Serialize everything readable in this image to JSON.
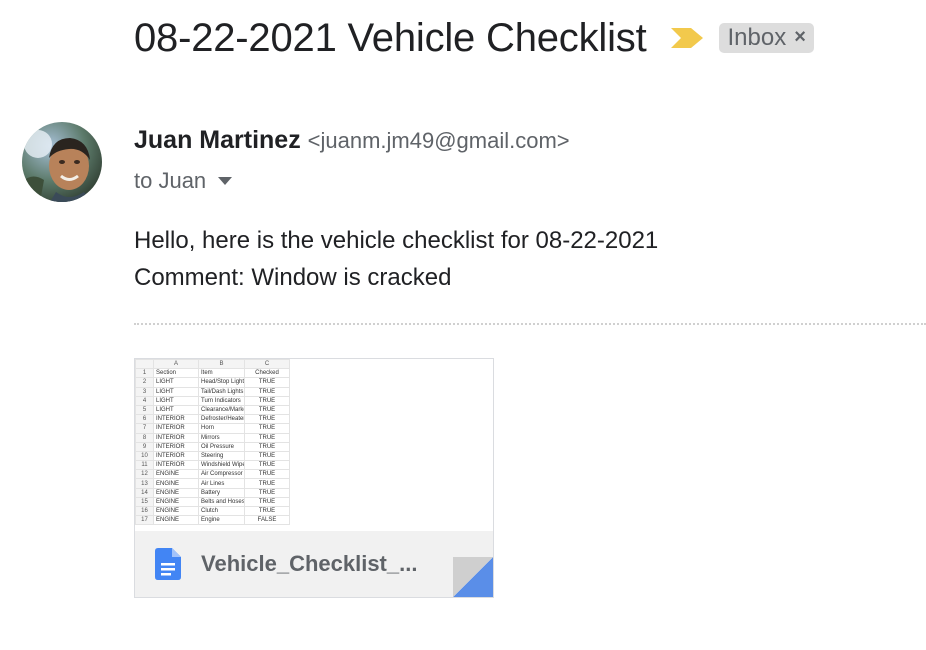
{
  "email": {
    "subject": "08-22-2021 Vehicle Checklist",
    "label": "Inbox",
    "label_remove_symbol": "×",
    "sender_name": "Juan Martinez",
    "sender_email": "<juanm.jm49@gmail.com>",
    "recipient": "to Juan",
    "body_line1": "Hello, here is the vehicle checklist for 08-22-2021",
    "body_line2": "Comment: Window is cracked"
  },
  "attachment": {
    "name": "Vehicle_Checklist_...",
    "icon": "google-docs-icon",
    "preview": {
      "columns": [
        "A",
        "B",
        "C"
      ],
      "rows": [
        [
          "1",
          "Section",
          "Item",
          "Checked"
        ],
        [
          "2",
          "LIGHT",
          "Head/Stop Lights",
          "TRUE"
        ],
        [
          "3",
          "LIGHT",
          "Tail/Dash Lights",
          "TRUE"
        ],
        [
          "4",
          "LIGHT",
          "Turn Indicators",
          "TRUE"
        ],
        [
          "5",
          "LIGHT",
          "Clearance/Marke",
          "TRUE"
        ],
        [
          "6",
          "INTERIOR",
          "Defroster/Heater",
          "TRUE"
        ],
        [
          "7",
          "INTERIOR",
          "Horn",
          "TRUE"
        ],
        [
          "8",
          "INTERIOR",
          "Mirrors",
          "TRUE"
        ],
        [
          "9",
          "INTERIOR",
          "Oil Pressure",
          "TRUE"
        ],
        [
          "10",
          "INTERIOR",
          "Steering",
          "TRUE"
        ],
        [
          "11",
          "INTERIOR",
          "Windshield Wipe",
          "TRUE"
        ],
        [
          "12",
          "ENGINE",
          "Air Compressor",
          "TRUE"
        ],
        [
          "13",
          "ENGINE",
          "Air Lines",
          "TRUE"
        ],
        [
          "14",
          "ENGINE",
          "Battery",
          "TRUE"
        ],
        [
          "15",
          "ENGINE",
          "Belts and Hoses",
          "TRUE"
        ],
        [
          "16",
          "ENGINE",
          "Clutch",
          "TRUE"
        ],
        [
          "17",
          "ENGINE",
          "Engine",
          "FALSE"
        ]
      ]
    }
  },
  "colors": {
    "importance_marker": "#f2c94c",
    "doc_icon": "#4285f4",
    "fold_corner": "#5a8ee8"
  }
}
